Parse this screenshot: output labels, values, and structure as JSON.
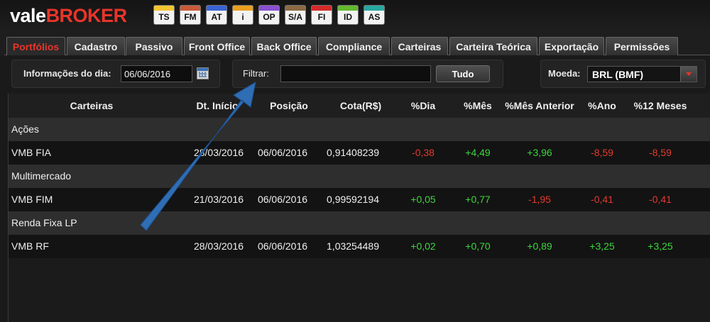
{
  "brand": {
    "part1": "vale",
    "part2": "BROKER"
  },
  "modules": [
    {
      "label": "TS",
      "color": "#f3c531"
    },
    {
      "label": "FM",
      "color": "#c85a3a"
    },
    {
      "label": "AT",
      "color": "#3a63d6"
    },
    {
      "label": "i",
      "color": "#e8a020"
    },
    {
      "label": "OP",
      "color": "#8a4fd1"
    },
    {
      "label": "S/A",
      "color": "#8b6a42"
    },
    {
      "label": "FI",
      "color": "#d42a2a"
    },
    {
      "label": "ID",
      "color": "#62b82e"
    },
    {
      "label": "AS",
      "color": "#27a8a0"
    }
  ],
  "tabs": [
    {
      "label": "Portfólios",
      "active": true
    },
    {
      "label": "Cadastro"
    },
    {
      "label": "Passivo"
    },
    {
      "label": "Front Office"
    },
    {
      "label": "Back Office"
    },
    {
      "label": "Compliance"
    },
    {
      "label": "Carteiras"
    },
    {
      "label": "Carteira Teórica"
    },
    {
      "label": "Exportação"
    },
    {
      "label": "Permissões"
    }
  ],
  "toolbar": {
    "date_label": "Informações do dia:",
    "date_value": "06/06/2016",
    "filter_label": "Filtrar:",
    "filter_value": "",
    "all_button": "Tudo",
    "currency_label": "Moeda:",
    "currency_value": "BRL (BMF)"
  },
  "table": {
    "headers": [
      "Carteiras",
      "Dt. Início",
      "Posição",
      "Cota(R$)",
      "%Dia",
      "%Mês",
      "%Mês Anterior",
      "%Ano",
      "%12 Meses"
    ],
    "groups": [
      {
        "name": "Ações",
        "rows": [
          {
            "cells": [
              "VMB FIA",
              "28/03/2016",
              "06/06/2016",
              "0,91408239",
              "-0,38",
              "+4,49",
              "+3,96",
              "-8,59",
              "-8,59"
            ]
          }
        ]
      },
      {
        "name": "Multimercado",
        "rows": [
          {
            "cells": [
              "VMB FIM",
              "21/03/2016",
              "06/06/2016",
              "0,99592194",
              "+0,05",
              "+0,77",
              "-1,95",
              "-0,41",
              "-0,41"
            ]
          }
        ]
      },
      {
        "name": "Renda Fixa LP",
        "rows": [
          {
            "cells": [
              "VMB RF",
              "28/03/2016",
              "06/06/2016",
              "1,03254489",
              "+0,02",
              "+0,70",
              "+0,89",
              "+3,25",
              "+3,25"
            ]
          }
        ]
      }
    ]
  },
  "colors": {
    "brand_red": "#e8352a",
    "positive": "#3cd63c",
    "negative": "#e23a2e",
    "annotation_arrow": "#2f6db4"
  }
}
